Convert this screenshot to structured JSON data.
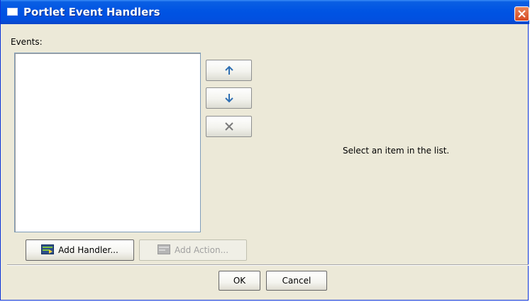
{
  "window": {
    "title": "Portlet Event Handlers",
    "colors": {
      "titlebar": "#0054e3",
      "close": "#d74a20",
      "face": "#ece9d8"
    }
  },
  "events_label": "Events:",
  "events_list": [],
  "side_buttons": [
    {
      "name": "move-up",
      "icon": "arrow-up-icon"
    },
    {
      "name": "move-down",
      "icon": "arrow-down-icon"
    },
    {
      "name": "remove",
      "icon": "delete-x-icon"
    }
  ],
  "status_text": "Select an item in the list.",
  "buttons": {
    "add_handler": "Add Handler...",
    "add_action": "Add Action...",
    "ok": "OK",
    "cancel": "Cancel"
  }
}
